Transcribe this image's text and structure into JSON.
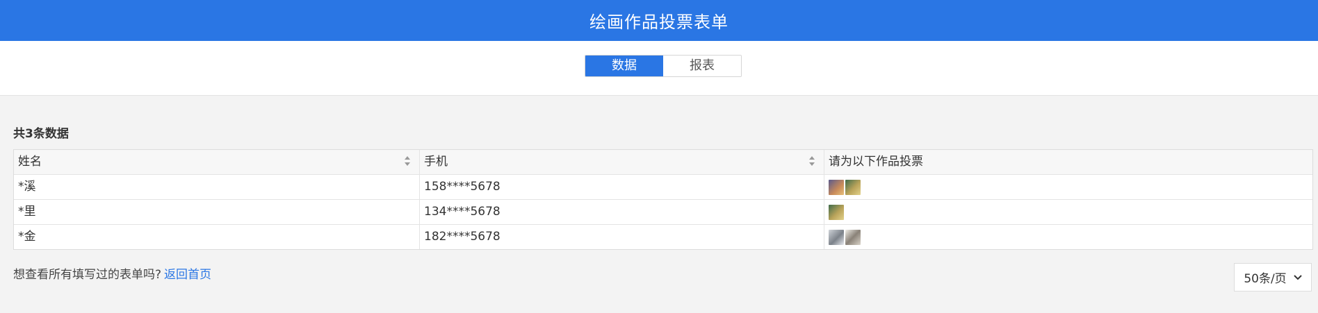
{
  "header": {
    "title": "绘画作品投票表单"
  },
  "tabs": [
    {
      "label": "数据",
      "active": true
    },
    {
      "label": "报表",
      "active": false
    }
  ],
  "summary": {
    "count_text": "共3条数据"
  },
  "table": {
    "columns": [
      "姓名",
      "手机",
      "请为以下作品投票"
    ],
    "rows": [
      {
        "name": "*溪",
        "phone": "158****5678",
        "images": [
          "artwork-thumbnail",
          "artwork-thumbnail"
        ]
      },
      {
        "name": "*里",
        "phone": "134****5678",
        "images": [
          "artwork-thumbnail"
        ]
      },
      {
        "name": "*金",
        "phone": "182****5678",
        "images": [
          "artwork-thumbnail",
          "artwork-thumbnail"
        ]
      }
    ]
  },
  "footer": {
    "question": "想查看所有填写过的表单吗?",
    "link": "返回首页"
  },
  "pagination": {
    "page_size": "50条/页"
  },
  "colors": {
    "accent": "#2a76e4",
    "background": "#f3f3f3"
  },
  "icons": [
    "sort-icon",
    "chevron-down-icon"
  ]
}
